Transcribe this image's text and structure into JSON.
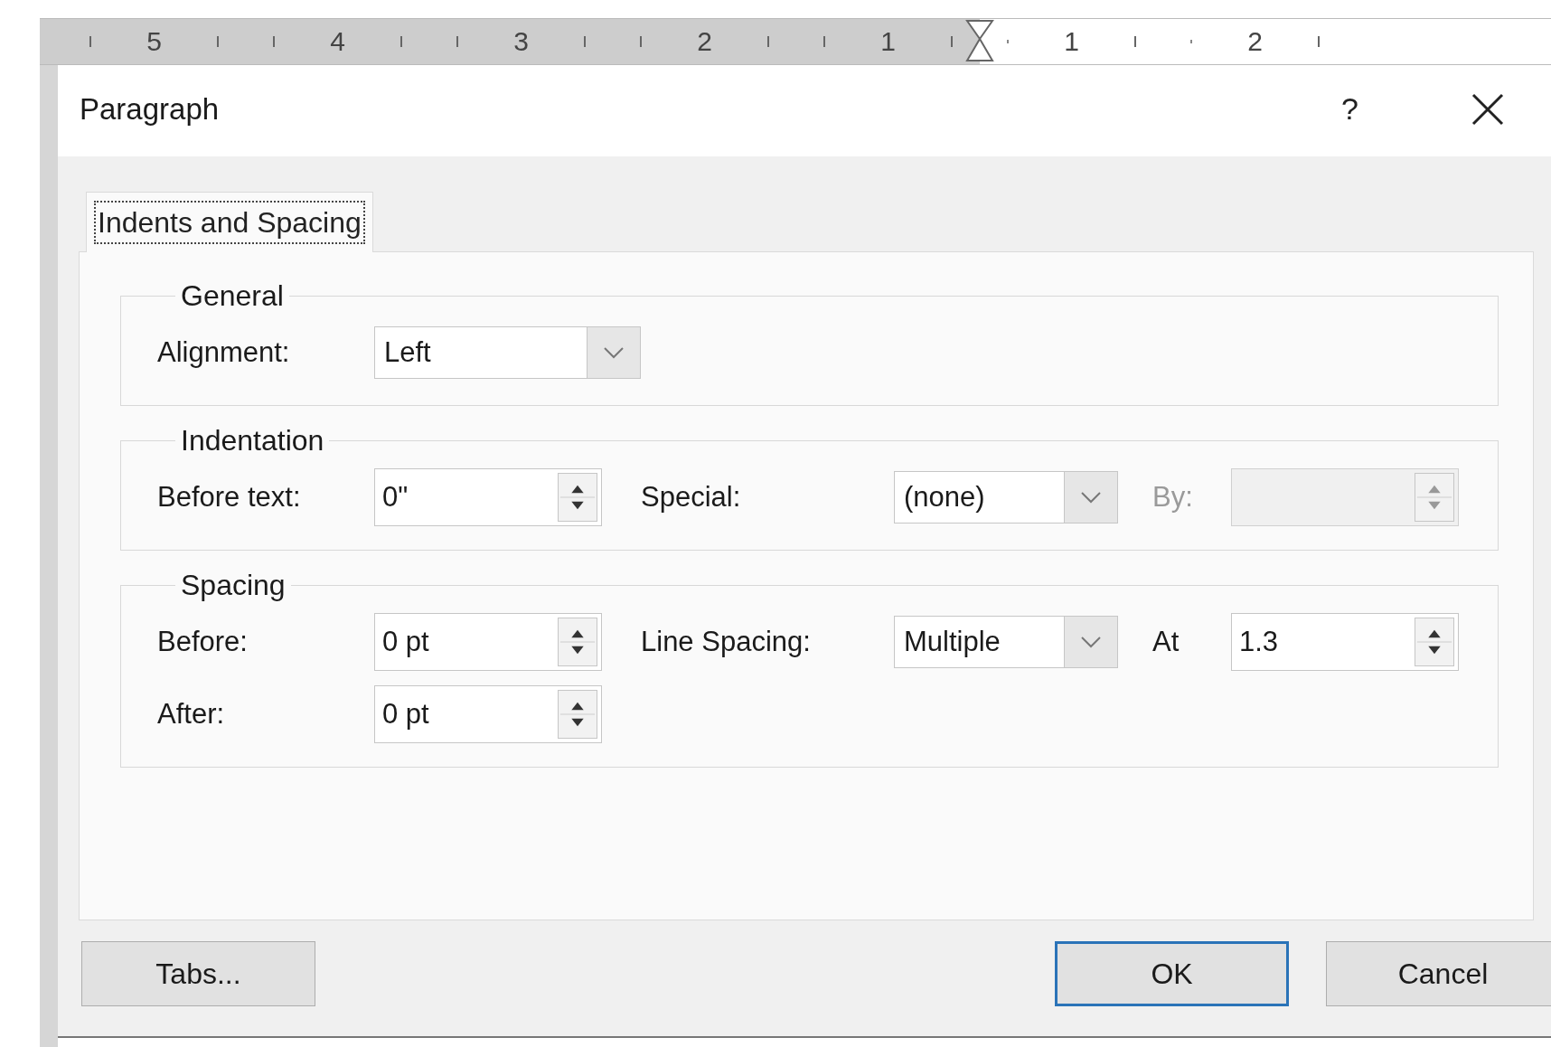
{
  "ruler": {
    "left_labels": [
      "5",
      "4",
      "3",
      "2",
      "1"
    ],
    "right_labels": [
      "1",
      "2"
    ]
  },
  "dialog": {
    "title": "Paragraph",
    "help_button": "?"
  },
  "tabs": [
    {
      "label": "Indents and Spacing",
      "selected": true,
      "focused": true
    }
  ],
  "groups": [
    {
      "title": "General",
      "rows": [
        [
          {
            "kind": "label",
            "text": "Alignment:",
            "disabled": false
          },
          {
            "kind": "combo",
            "value": "Left",
            "disabled": false
          }
        ]
      ]
    },
    {
      "title": "Indentation",
      "rows": [
        [
          {
            "kind": "label",
            "text": "Before text:",
            "disabled": false
          },
          {
            "kind": "spin",
            "value": "0\"",
            "disabled": false
          },
          {
            "kind": "label",
            "text": "Special:",
            "disabled": false
          },
          {
            "kind": "combo",
            "value": "(none)",
            "disabled": false
          },
          {
            "kind": "label",
            "text": "By:",
            "disabled": true
          },
          {
            "kind": "spin",
            "disabled": true
          }
        ]
      ]
    },
    {
      "title": "Spacing",
      "rows": [
        [
          {
            "kind": "label",
            "text": "Before:",
            "disabled": false
          },
          {
            "kind": "spin",
            "value": "0 pt",
            "disabled": false
          },
          {
            "kind": "label",
            "text": "Line Spacing:",
            "disabled": false
          },
          {
            "kind": "combo",
            "value": "Multiple",
            "disabled": false
          },
          {
            "kind": "label",
            "text": "At",
            "disabled": false
          },
          {
            "kind": "spin",
            "value": "1.3",
            "disabled": false
          }
        ],
        [
          {
            "kind": "label",
            "text": "After:",
            "disabled": false
          },
          {
            "kind": "spin",
            "value": "0 pt",
            "disabled": false
          }
        ]
      ]
    }
  ],
  "left_buttons": [
    {
      "label": "Tabs...",
      "default": false
    }
  ],
  "right_buttons": [
    {
      "label": "OK",
      "default": true
    },
    {
      "label": "Cancel",
      "default": false
    }
  ]
}
